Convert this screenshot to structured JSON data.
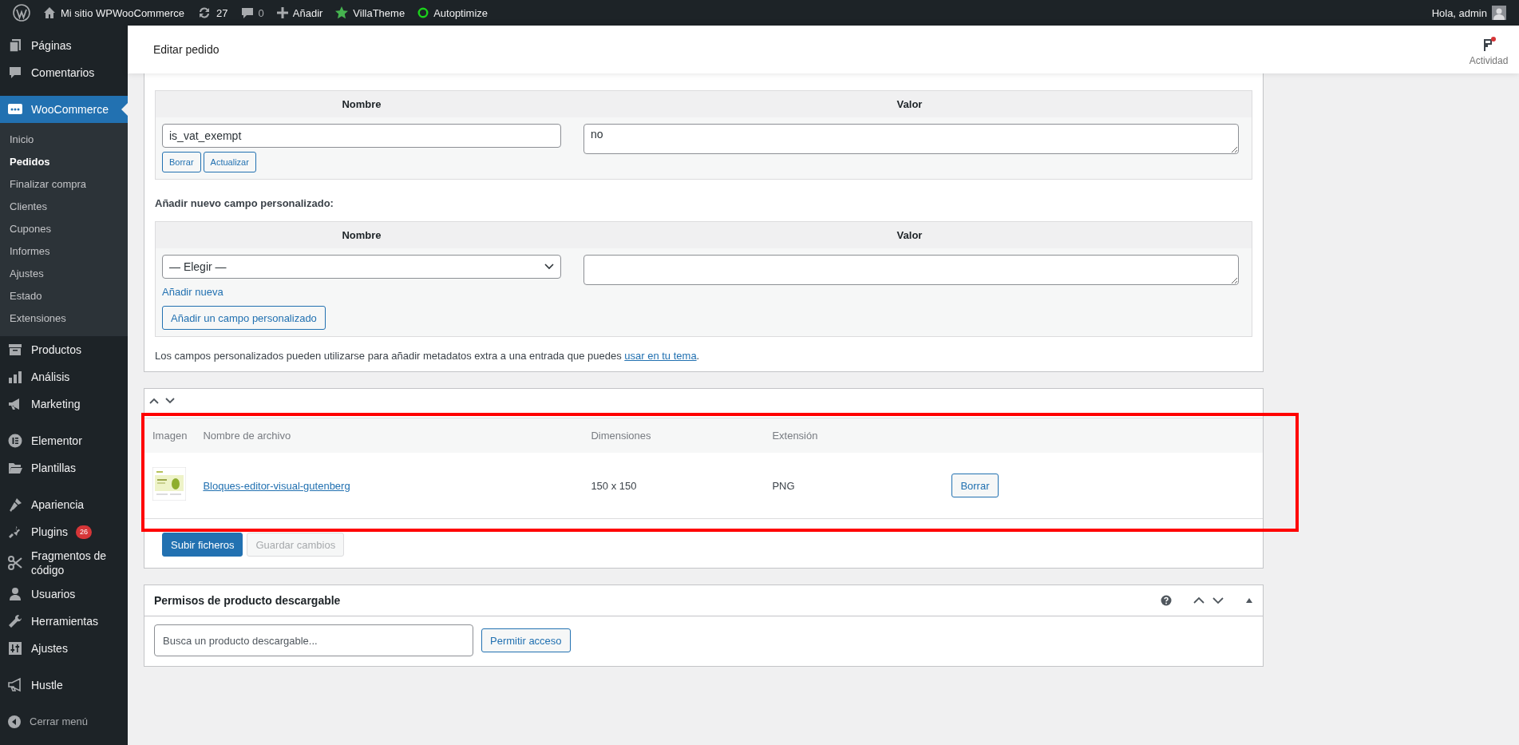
{
  "admin_bar": {
    "site": "Mi sitio WPWooCommerce",
    "updates": "27",
    "comments": "0",
    "new": "Añadir",
    "villatheme": "VillaTheme",
    "autoptimize": "Autoptimize",
    "greeting": "Hola, admin"
  },
  "sidebar": {
    "groups": [
      [
        {
          "label": "Páginas",
          "kind": "pages",
          "selected": false
        },
        {
          "label": "Comentarios",
          "kind": "comments",
          "selected": false
        }
      ],
      [
        {
          "label": "WooCommerce",
          "kind": "woo",
          "selected": true,
          "children": [
            {
              "label": "Inicio",
              "selected": false
            },
            {
              "label": "Pedidos",
              "selected": true
            },
            {
              "label": "Finalizar compra",
              "selected": false
            },
            {
              "label": "Clientes",
              "selected": false
            },
            {
              "label": "Cupones",
              "selected": false
            },
            {
              "label": "Informes",
              "selected": false
            },
            {
              "label": "Ajustes",
              "selected": false
            },
            {
              "label": "Estado",
              "selected": false
            },
            {
              "label": "Extensiones",
              "selected": false
            }
          ]
        },
        {
          "label": "Productos",
          "kind": "products",
          "selected": false
        },
        {
          "label": "Análisis",
          "kind": "analytics",
          "selected": false
        },
        {
          "label": "Marketing",
          "kind": "marketing",
          "selected": false
        }
      ],
      [
        {
          "label": "Elementor",
          "kind": "elementor",
          "selected": false
        },
        {
          "label": "Plantillas",
          "kind": "templates",
          "selected": false
        }
      ],
      [
        {
          "label": "Apariencia",
          "kind": "appearance",
          "selected": false
        },
        {
          "label": "Plugins",
          "kind": "plugins",
          "selected": false,
          "badge": "26"
        },
        {
          "label": "Fragmentos de código",
          "kind": "snippets",
          "selected": false
        },
        {
          "label": "Usuarios",
          "kind": "users",
          "selected": false
        },
        {
          "label": "Herramientas",
          "kind": "tools",
          "selected": false
        },
        {
          "label": "Ajustes",
          "kind": "settings",
          "selected": false
        }
      ],
      [
        {
          "label": "Hustle",
          "kind": "hustle",
          "selected": false
        }
      ]
    ],
    "collapse": "Cerrar menú"
  },
  "header": {
    "title": "Editar pedido",
    "activity": "Actividad",
    "activity_unread": true
  },
  "custom_fields": {
    "columns": [
      "Nombre",
      "Valor"
    ],
    "rows": [
      {
        "name": "is_vat_exempt",
        "value": "no",
        "buttons": [
          "Borrar",
          "Actualizar"
        ]
      }
    ],
    "add_title": "Añadir nuevo campo personalizado:",
    "add_columns": [
      "Nombre",
      "Valor"
    ],
    "select": "— Elegir —",
    "add_new_link": "Añadir nueva",
    "add_button": "Añadir un campo personalizado",
    "note": "Los campos personalizados pueden utilizarse para añadir metadatos extra a una entrada que puedes ",
    "note_link": "usar en tu tema",
    "note_end": "."
  },
  "files_panel": {
    "highlighted": true,
    "columns": [
      "Imagen",
      "Nombre de archivo",
      "Dimensiones",
      "Extensión"
    ],
    "rows": [
      {
        "name": "Bloques-editor-visual-gutenberg",
        "dimensions": "150 x 150",
        "extension": "PNG",
        "button": "Borrar"
      }
    ],
    "upload_button": "Subir ficheros",
    "save_button": {
      "label": "Guardar cambios",
      "disabled": true
    }
  },
  "downloads_panel": {
    "title": "Permisos de producto descargable",
    "search_placeholder": "Busca un producto descargable...",
    "grant_button": "Permitir acceso"
  }
}
